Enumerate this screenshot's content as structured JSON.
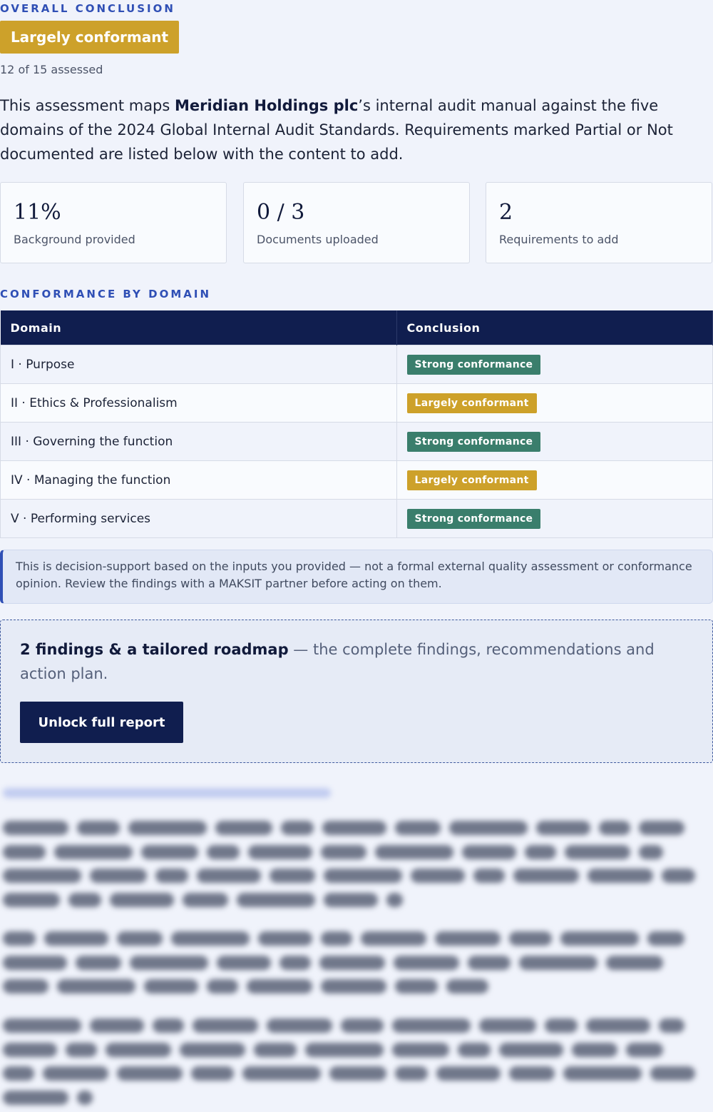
{
  "overall": {
    "eyebrow": "OVERALL CONCLUSION",
    "badge": "Largely conformant",
    "assessed": "12 of 15 assessed"
  },
  "intro": {
    "before": "This assessment maps ",
    "company": "Meridian Holdings plc",
    "after": "’s internal audit manual against the five domains of the 2024 Global Internal Audit Standards. Requirements marked Partial or Not documented are listed below with the content to add."
  },
  "cards": [
    {
      "value": "11%",
      "label": "Background provided"
    },
    {
      "value": "0 / 3",
      "label": "Documents uploaded"
    },
    {
      "value": "2",
      "label": "Requirements to add"
    }
  ],
  "domains": {
    "eyebrow": "CONFORMANCE BY DOMAIN",
    "headers": [
      "Domain",
      "Conclusion"
    ],
    "rows": [
      {
        "domain": "I · Purpose",
        "conclusion": "Strong conformance"
      },
      {
        "domain": "II · Ethics & Professionalism",
        "conclusion": "Largely conformant"
      },
      {
        "domain": "III · Governing the function",
        "conclusion": "Strong conformance"
      },
      {
        "domain": "IV · Managing the function",
        "conclusion": "Largely conformant"
      },
      {
        "domain": "V · Performing services",
        "conclusion": "Strong conformance"
      }
    ]
  },
  "notice": "This is decision-support based on the inputs you provided — not a formal external quality assessment or conformance opinion. Review the findings with a MAKSIT partner before acting on them.",
  "unlock": {
    "headline": "2 findings & a tailored roadmap",
    "text": " — the complete findings, recommendations and action plan.",
    "button": "Unlock full report"
  },
  "colors": {
    "navy": "#101e4f",
    "accent_blue": "#2f4fb5",
    "strong_green": "#3a7e6c",
    "largely_gold": "#cda12a"
  }
}
